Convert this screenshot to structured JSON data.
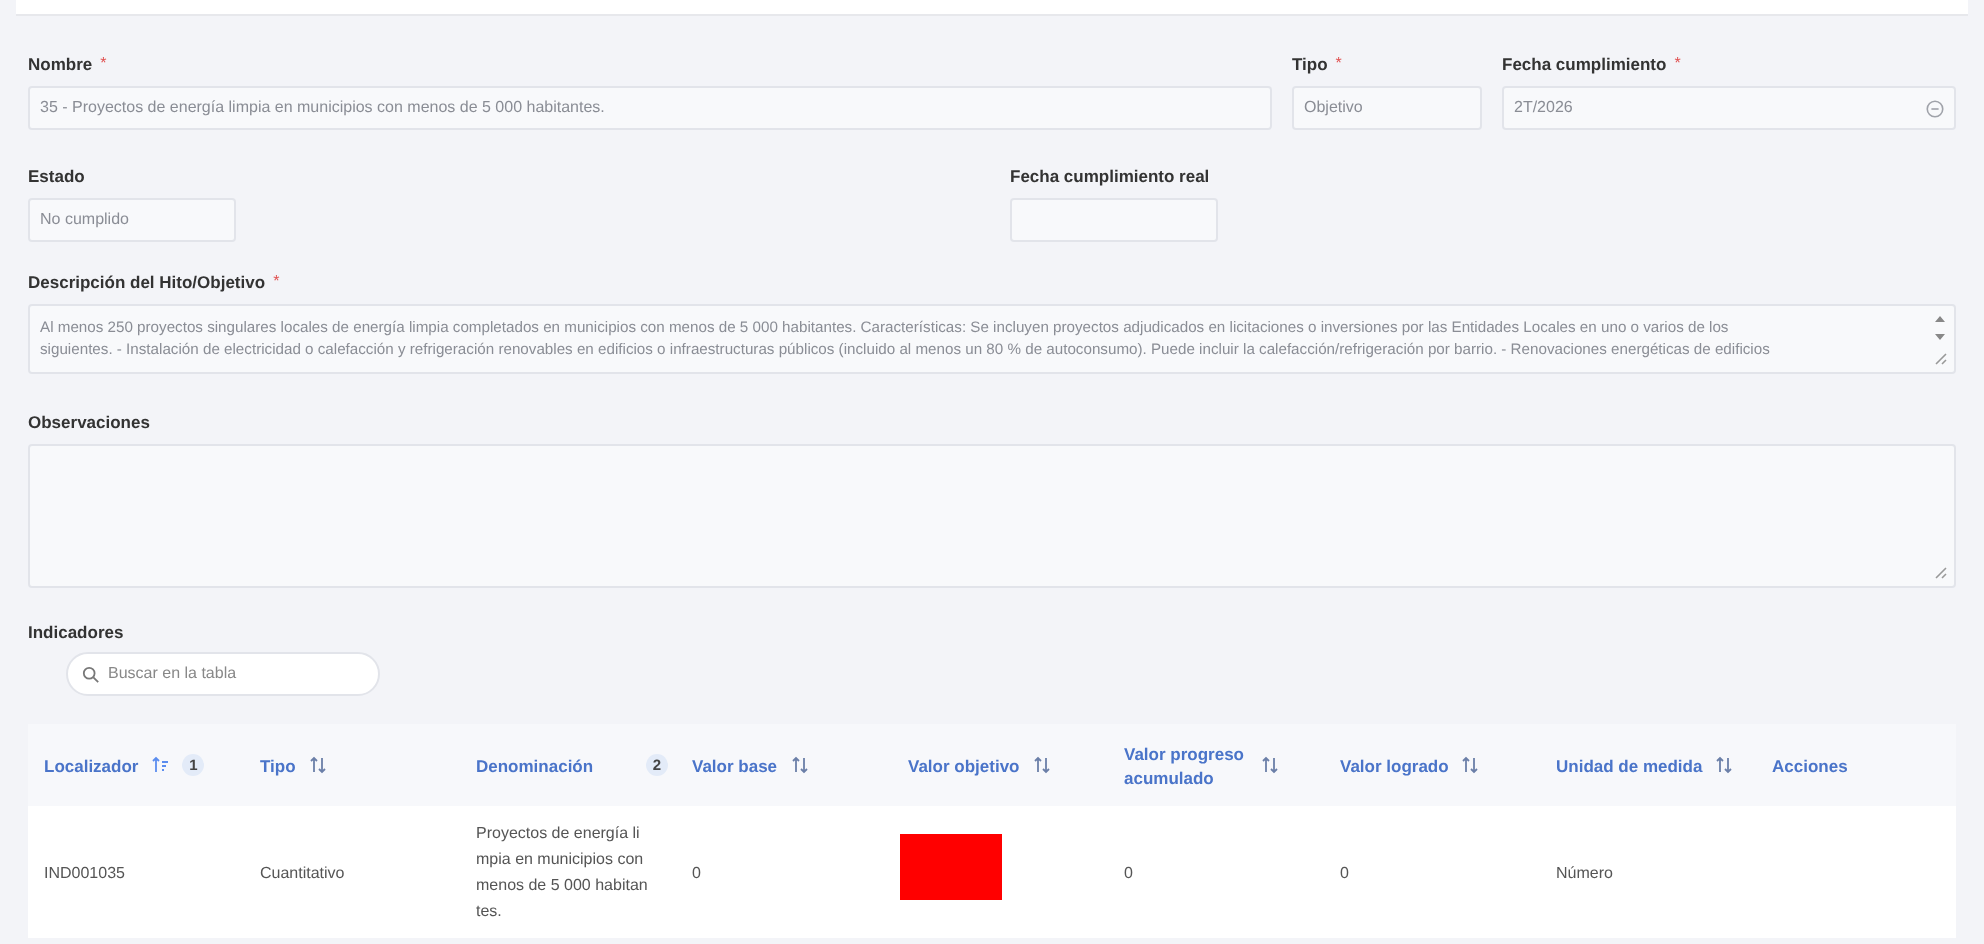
{
  "nombre": {
    "label": "Nombre",
    "required_mark": "*",
    "value": "35 - Proyectos de energía limpia en municipios con menos de 5 000 habitantes."
  },
  "tipo": {
    "label": "Tipo",
    "required_mark": "*",
    "value": "Objetivo"
  },
  "fecha_cumplimiento": {
    "label": "Fecha cumplimiento",
    "required_mark": "*",
    "value": "2T/2026"
  },
  "estado": {
    "label": "Estado",
    "value": "No cumplido"
  },
  "fecha_cumplimiento_real": {
    "label": "Fecha cumplimiento real"
  },
  "descripcion": {
    "label": "Descripción del Hito/Objetivo",
    "required_mark": "*",
    "lines": [
      "Al menos 250 proyectos singulares locales de energía limpia completados en municipios con menos de 5 000 habitantes. Características: Se incluyen proyectos adjudicados en licitaciones o inversiones por las Entidades Locales en uno o varios de los",
      "siguientes. - Instalación de electricidad o calefacción y refrigeración renovables en edificios o infraestructuras públicos (incluido al menos un 80 % de autoconsumo). Puede incluir la calefacción/refrigeración por barrio. - Renovaciones energéticas de edificios"
    ]
  },
  "observaciones": {
    "label": "Observaciones"
  },
  "indicadores": {
    "title": "Indicadores",
    "search": {
      "placeholder": "Buscar en la tabla"
    },
    "table": {
      "columns": [
        {
          "label": "Localizador",
          "sortable": true,
          "sorted": true,
          "badge": "1"
        },
        {
          "label": "Tipo",
          "sortable": true,
          "sorted": false
        },
        {
          "label": "Denominación",
          "sortable": false,
          "badge": "2"
        },
        {
          "label": "Valor base",
          "sortable": true,
          "sorted": false
        },
        {
          "label": "Valor objetivo",
          "sortable": true,
          "sorted": false
        },
        {
          "label": "Valor progreso acumulado",
          "sortable": true,
          "sorted": false
        },
        {
          "label": "Valor logrado",
          "sortable": true,
          "sorted": false
        },
        {
          "label": "Unidad de medida",
          "sortable": true,
          "sorted": false
        },
        {
          "label": "Acciones",
          "sortable": false
        }
      ],
      "rows": [
        {
          "cells": [
            {
              "kind": "text",
              "text": "IND001035"
            },
            {
              "kind": "text",
              "text": "Cuantitativo"
            },
            {
              "kind": "text",
              "text": "Proyectos de energía li mpia en municipios con menos de 5 000 habitan tes."
            },
            {
              "kind": "text",
              "text": "0"
            },
            {
              "kind": "redacted"
            },
            {
              "kind": "text",
              "text": "0"
            },
            {
              "kind": "text",
              "text": "0"
            },
            {
              "kind": "text",
              "text": "Número"
            },
            {
              "kind": "empty"
            }
          ]
        }
      ]
    }
  }
}
